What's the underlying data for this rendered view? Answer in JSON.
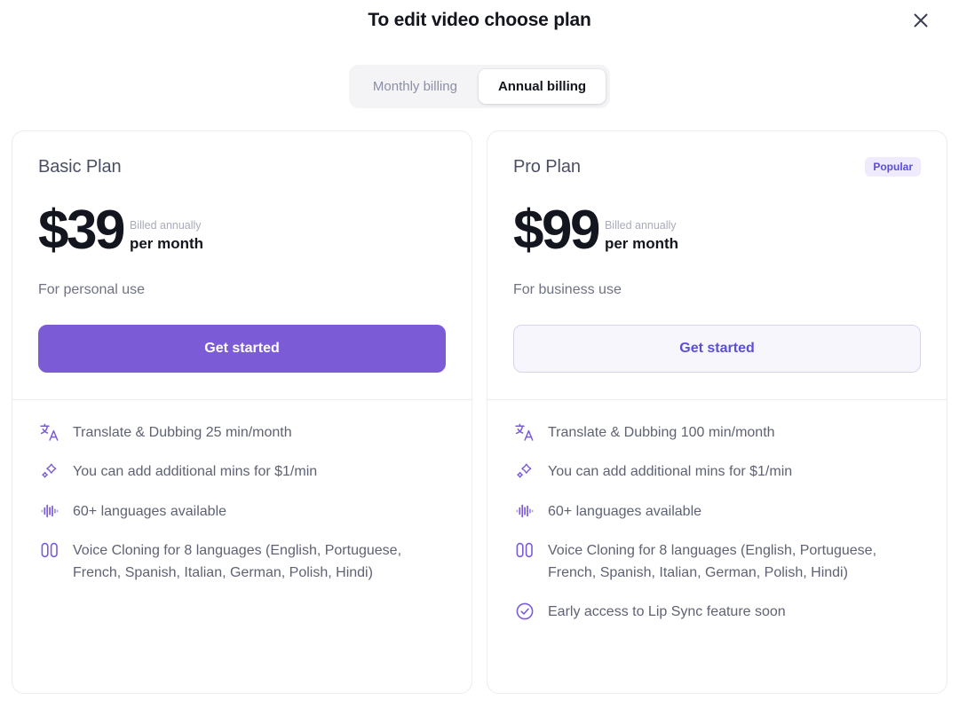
{
  "modal": {
    "title": "To edit video choose plan",
    "close_icon": "close-icon"
  },
  "billing": {
    "options": [
      {
        "label": "Monthly billing",
        "active": false
      },
      {
        "label": "Annual billing",
        "active": true
      }
    ],
    "monthly_label": "Monthly billing",
    "annual_label": "Annual billing"
  },
  "colors": {
    "accent": "#7c5cd6",
    "accent_text": "#5b4fd6",
    "badge_bg": "#efeafc",
    "card_border": "#ececf1",
    "title": "#14161f",
    "muted_text": "#5f6274"
  },
  "plans": [
    {
      "name": "Basic Plan",
      "badge": "",
      "price": "$39",
      "billed_note": "Billed annually",
      "period": "per month",
      "audience": "For personal use",
      "cta_label": "Get started",
      "cta_style": "primary",
      "features": [
        {
          "icon": "translate-icon",
          "text": "Translate & Dubbing 25 min/month"
        },
        {
          "icon": "sparkle-wand-icon",
          "text": "You can add additional mins for $1/min"
        },
        {
          "icon": "waveform-icon",
          "text": "60+ languages available"
        },
        {
          "icon": "voice-clone-icon",
          "text": "Voice Cloning for 8 languages (English, Portuguese, French, Spanish, Italian, German, Polish, Hindi)"
        }
      ]
    },
    {
      "name": "Pro Plan",
      "badge": "Popular",
      "price": "$99",
      "billed_note": "Billed annually",
      "period": "per month",
      "audience": "For business use",
      "cta_label": "Get started",
      "cta_style": "outline",
      "features": [
        {
          "icon": "translate-icon",
          "text": "Translate & Dubbing 100 min/month"
        },
        {
          "icon": "sparkle-wand-icon",
          "text": "You can add additional mins for $1/min"
        },
        {
          "icon": "waveform-icon",
          "text": "60+ languages available"
        },
        {
          "icon": "voice-clone-icon",
          "text": "Voice Cloning for 8 languages (English, Portuguese, French, Spanish, Italian, German, Polish, Hindi)"
        },
        {
          "icon": "check-circle-icon",
          "text": "Early access to Lip Sync feature soon"
        }
      ]
    }
  ]
}
